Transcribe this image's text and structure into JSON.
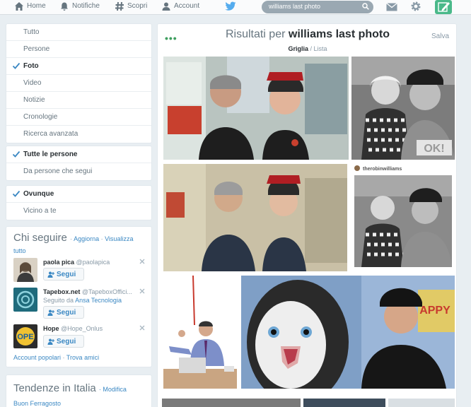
{
  "nav": {
    "home": "Home",
    "notifications": "Notifiche",
    "discover": "Scopri",
    "account": "Account"
  },
  "search": {
    "value": "williams last photo"
  },
  "filters": {
    "type": [
      {
        "label": "Tutto",
        "active": false
      },
      {
        "label": "Persone",
        "active": false
      },
      {
        "label": "Foto",
        "active": true
      },
      {
        "label": "Video",
        "active": false
      },
      {
        "label": "Notizie",
        "active": false
      },
      {
        "label": "Cronologie",
        "active": false
      },
      {
        "label": "Ricerca avanzata",
        "active": false
      }
    ],
    "people": [
      {
        "label": "Tutte le persone",
        "active": true
      },
      {
        "label": "Da persone che segui",
        "active": false
      }
    ],
    "place": [
      {
        "label": "Ovunque",
        "active": true
      },
      {
        "label": "Vicino a te",
        "active": false
      }
    ]
  },
  "who_to_follow": {
    "title": "Chi seguire",
    "refresh": "Aggiorna",
    "view_all": "Visualizza tutto",
    "suggestions": [
      {
        "name": "paola pica",
        "handle": "@paolapica",
        "sub_prefix": "",
        "sub_link": "",
        "follow": "Segui"
      },
      {
        "name": "Tapebox.net",
        "handle": "@TapeboxOffici...",
        "sub_prefix": "Seguito da",
        "sub_link": "Ansa Tecnologia",
        "follow": "Segui"
      },
      {
        "name": "Hope",
        "handle": "@Hope_Onlus",
        "sub_prefix": "",
        "sub_link": "",
        "follow": "Segui"
      }
    ],
    "popular": "Account popolari",
    "find_friends": "Trova amici"
  },
  "trends": {
    "title": "Tendenze in Italia",
    "change": "Modifica",
    "items": [
      "Buon Ferragosto"
    ]
  },
  "results": {
    "prefix": "Risultati per",
    "query": "williams last photo",
    "view_grid": "Griglia",
    "view_list": "Lista",
    "save": "Salva",
    "watermark": "OK!",
    "photo_caption": "therobinwilliams",
    "sign_text": "APPY"
  },
  "colors": {
    "accent": "#3b88c3",
    "compose": "#4ab98a",
    "text": "#292f33",
    "muted": "#66757f"
  }
}
